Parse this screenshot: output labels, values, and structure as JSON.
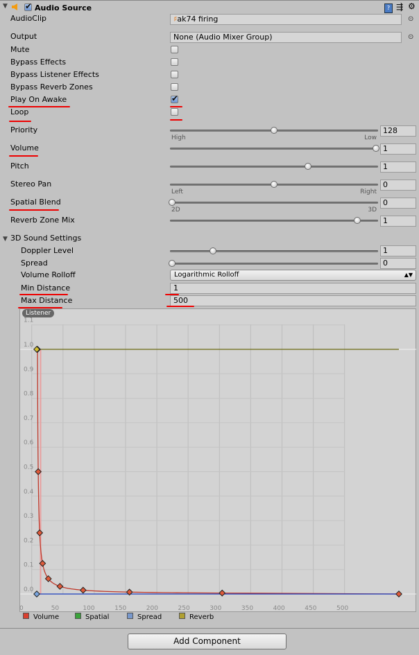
{
  "header": {
    "title": "Audio Source",
    "enabled": true,
    "icons": [
      "foldout-triangle-icon",
      "speaker-icon",
      "help-book-icon",
      "presets-icon",
      "gear-icon"
    ]
  },
  "fields": {
    "audio_clip": {
      "label": "AudioClip",
      "value": "ak74 firing",
      "icon": "audio-clip-icon"
    },
    "output": {
      "label": "Output",
      "value": "None (Audio Mixer Group)"
    }
  },
  "toggles": [
    {
      "label": "Mute",
      "checked": false
    },
    {
      "label": "Bypass Effects",
      "checked": false
    },
    {
      "label": "Bypass Listener Effects",
      "checked": false
    },
    {
      "label": "Bypass Reverb Zones",
      "checked": false
    },
    {
      "label": "Play On Awake",
      "checked": true
    },
    {
      "label": "Loop",
      "checked": false
    }
  ],
  "sliders": [
    {
      "label": "Priority",
      "value": "128",
      "fraction": 0.5,
      "min_label": "High",
      "max_label": "Low"
    },
    {
      "label": "Volume",
      "value": "1",
      "fraction": 1.0
    },
    {
      "label": "Pitch",
      "value": "1",
      "fraction": 0.667
    },
    {
      "label": "Stereo Pan",
      "value": "0",
      "fraction": 0.5,
      "min_label": "Left",
      "max_label": "Right"
    },
    {
      "label": "Spatial Blend",
      "value": "0",
      "fraction": 0.0,
      "min_label": "2D",
      "max_label": "3D"
    },
    {
      "label": "Reverb Zone Mix",
      "value": "1",
      "fraction": 0.909
    }
  ],
  "sound3d": {
    "title": "3D Sound Settings",
    "doppler": {
      "label": "Doppler Level",
      "value": "1",
      "fraction": 0.2
    },
    "spread": {
      "label": "Spread",
      "value": "0",
      "fraction": 0.0
    },
    "rolloff": {
      "label": "Volume Rolloff",
      "value": "Logarithmic Rolloff"
    },
    "min_distance": {
      "label": "Min Distance",
      "value": "1"
    },
    "max_distance": {
      "label": "Max Distance",
      "value": "500"
    }
  },
  "annotation_color": "#e00000",
  "chart_data": {
    "type": "line",
    "badge": "Listener",
    "x_ticks": [
      "0",
      "50",
      "100",
      "150",
      "200",
      "250",
      "300",
      "350",
      "400",
      "450",
      "500"
    ],
    "y_ticks": [
      "0.0",
      "0.1",
      "0.2",
      "0.3",
      "0.4",
      "0.5",
      "0.6",
      "0.7",
      "0.8",
      "0.9",
      "1.0",
      "1.1"
    ],
    "ylim": [
      0,
      1.1
    ],
    "grid": true,
    "legend_placement": "bottom-left",
    "series": [
      {
        "name": "Volume",
        "color": "#c0392b",
        "x": [
          1,
          2,
          4,
          8,
          16,
          32,
          64,
          128,
          256,
          500
        ],
        "y": [
          1,
          0.5,
          0.25,
          0.125,
          0.0625,
          0.03125,
          0.0156,
          0.0078,
          0.0039,
          0
        ]
      },
      {
        "name": "Spatial",
        "color": "#3aa33a",
        "x": [],
        "y": []
      },
      {
        "name": "Spread",
        "color": "#1d3fbf",
        "x": [
          0,
          500
        ],
        "y": [
          0,
          0
        ]
      },
      {
        "name": "Reverb",
        "color": "#6b6a10",
        "x": [
          0,
          500
        ],
        "y": [
          1,
          1
        ]
      }
    ]
  },
  "add_component": "Add Component"
}
